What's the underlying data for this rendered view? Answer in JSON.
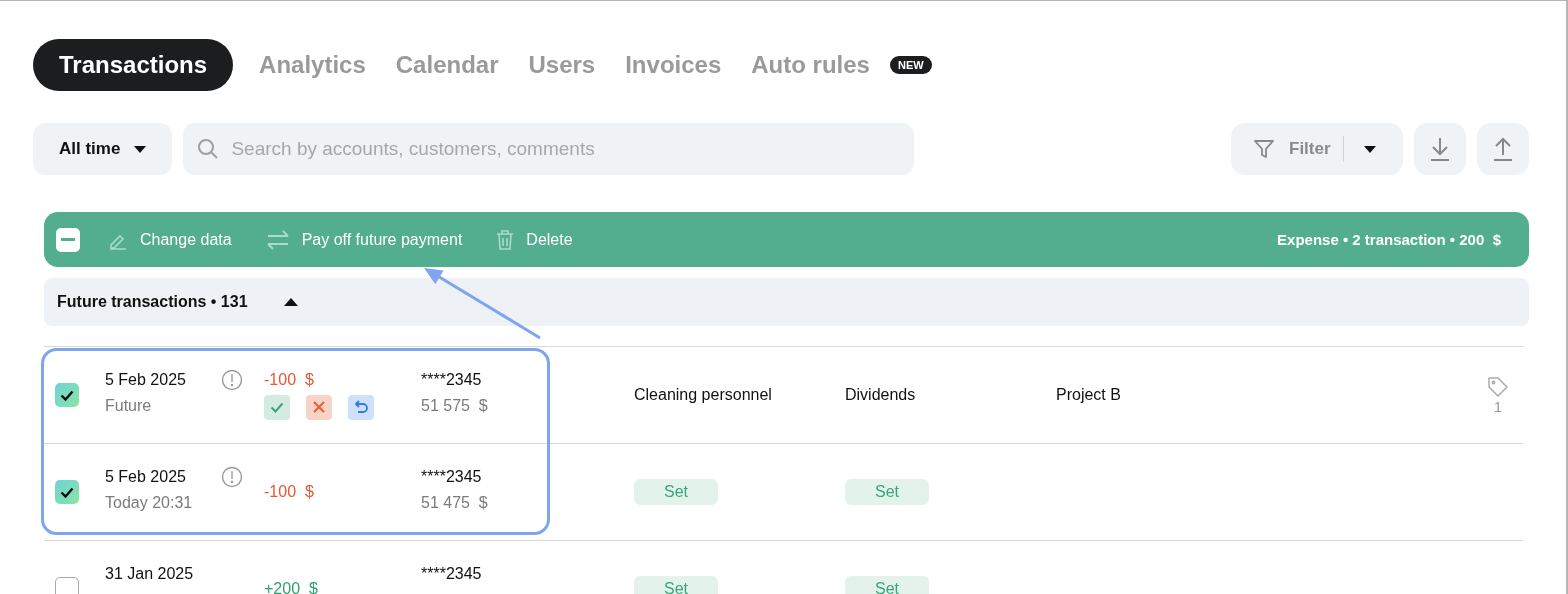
{
  "tabs": [
    {
      "label": "Transactions",
      "selected": true
    },
    {
      "label": "Analytics",
      "selected": false
    },
    {
      "label": "Calendar",
      "selected": false
    },
    {
      "label": "Users",
      "selected": false
    },
    {
      "label": "Invoices",
      "selected": false
    },
    {
      "label": "Auto rules",
      "selected": false,
      "badge": "NEW"
    }
  ],
  "period": {
    "label": "All time"
  },
  "search": {
    "placeholder": "Search by accounts, customers, comments"
  },
  "filter": {
    "label": "Filter"
  },
  "bulk_bar": {
    "indeterminate": true,
    "actions": [
      {
        "kind": "edit",
        "label": "Change data"
      },
      {
        "kind": "transfer",
        "label": "Pay off future payment"
      },
      {
        "kind": "delete",
        "label": "Delete"
      }
    ],
    "summary": "Expense • 2 transaction • 200  $"
  },
  "group": {
    "title": "Future transactions • 131",
    "expanded": true
  },
  "rows": [
    {
      "checked": true,
      "date": "5 Feb 2025",
      "sub": "Future",
      "warning": true,
      "amount": "-100  $",
      "kind": "expense",
      "pending_actions": true,
      "account": "****2345",
      "balance": "51 575  $",
      "category": {
        "kind": "text",
        "text": "Cleaning personnel"
      },
      "article": {
        "kind": "text",
        "text": "Dividends"
      },
      "project": "Project B",
      "tags": "1"
    },
    {
      "checked": true,
      "date": "5 Feb 2025",
      "sub": "Today 20:31",
      "warning": true,
      "amount": "-100  $",
      "kind": "expense",
      "pending_actions": false,
      "account": "****2345",
      "balance": "51 475  $",
      "category": {
        "kind": "set",
        "text": "Set"
      },
      "article": {
        "kind": "set",
        "text": "Set"
      }
    },
    {
      "checked": false,
      "date": "31 Jan 2025",
      "warning": false,
      "amount": "+200  $",
      "kind": "income",
      "pending_actions": false,
      "account": "****2345",
      "category": {
        "kind": "set",
        "text": "Set"
      },
      "article": {
        "kind": "set",
        "text": "Set"
      }
    }
  ]
}
